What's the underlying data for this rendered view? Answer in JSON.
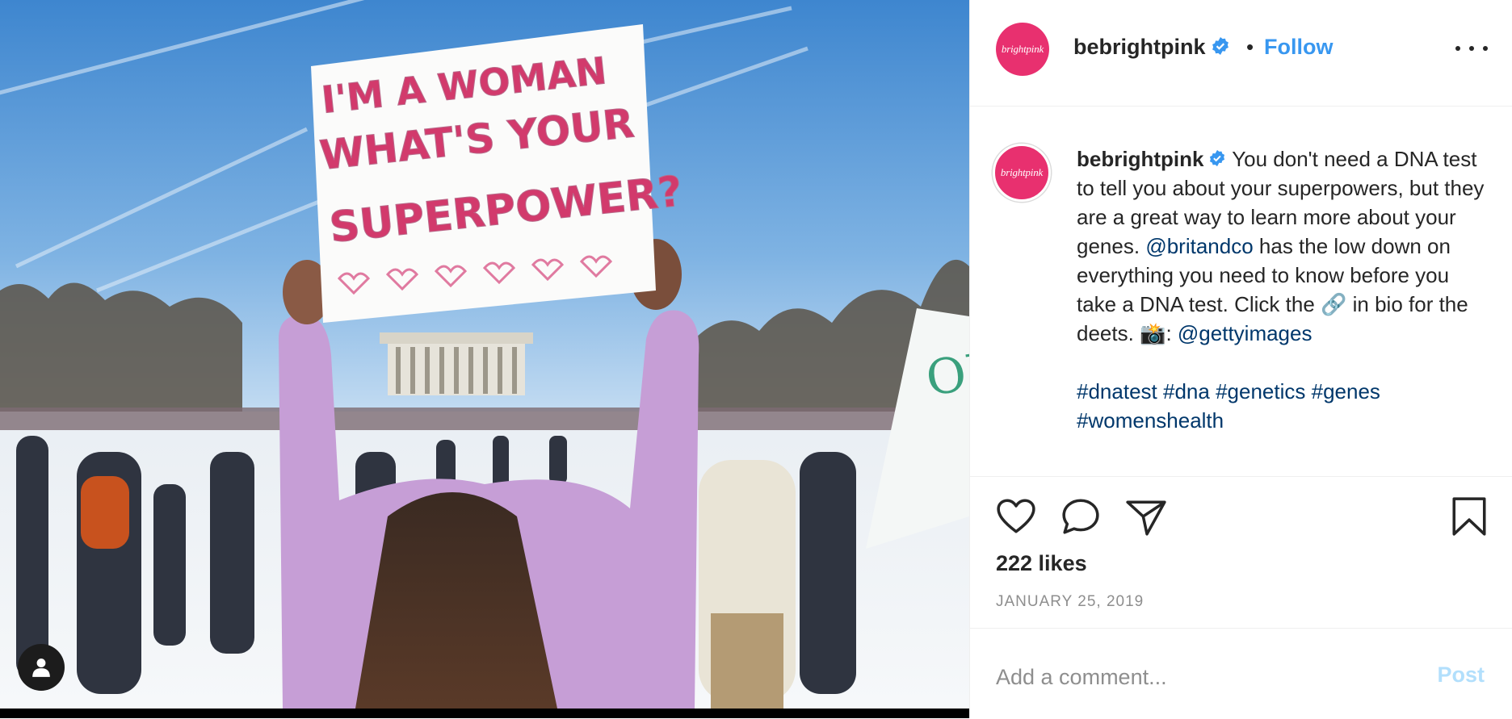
{
  "post": {
    "username": "bebrightpink",
    "avatar_text": "brightpink",
    "follow_label": "Follow",
    "separator": "•",
    "more_icon": "ellipsis-icon",
    "verified_icon": "verified-badge-icon"
  },
  "image": {
    "sign_lines": [
      "I'M A WOMAN",
      "WHAT'S YOUR",
      "SUPERPOWER?"
    ],
    "tag_icon": "person-icon"
  },
  "caption": {
    "username": "bebrightpink",
    "text_1": "You don't need a DNA test to tell you about your superpowers, but they are a great way to learn more about your genes.",
    "mention_1": "@britandco",
    "text_2": "has the low down on everything you need to know before you take a DNA test. Click the",
    "link_emoji": "🔗",
    "text_3": "in bio for the deets.",
    "camera_emoji": "📸",
    "colon": ":",
    "mention_2": "@gettyimages",
    "hashtags": [
      "#dnatest",
      "#dna",
      "#genetics",
      "#genes",
      "#womenshealth"
    ]
  },
  "actions": {
    "like_icon": "heart-icon",
    "comment_icon": "comment-icon",
    "share_icon": "paper-plane-icon",
    "save_icon": "bookmark-icon"
  },
  "stats": {
    "likes": "222 likes",
    "date": "JANUARY 25, 2019"
  },
  "comment": {
    "placeholder": "Add a comment...",
    "post_label": "Post"
  },
  "colors": {
    "accent": "#3897f0",
    "brand": "#e8306f",
    "link": "#00376b",
    "post_disabled": "#b2dffc"
  }
}
